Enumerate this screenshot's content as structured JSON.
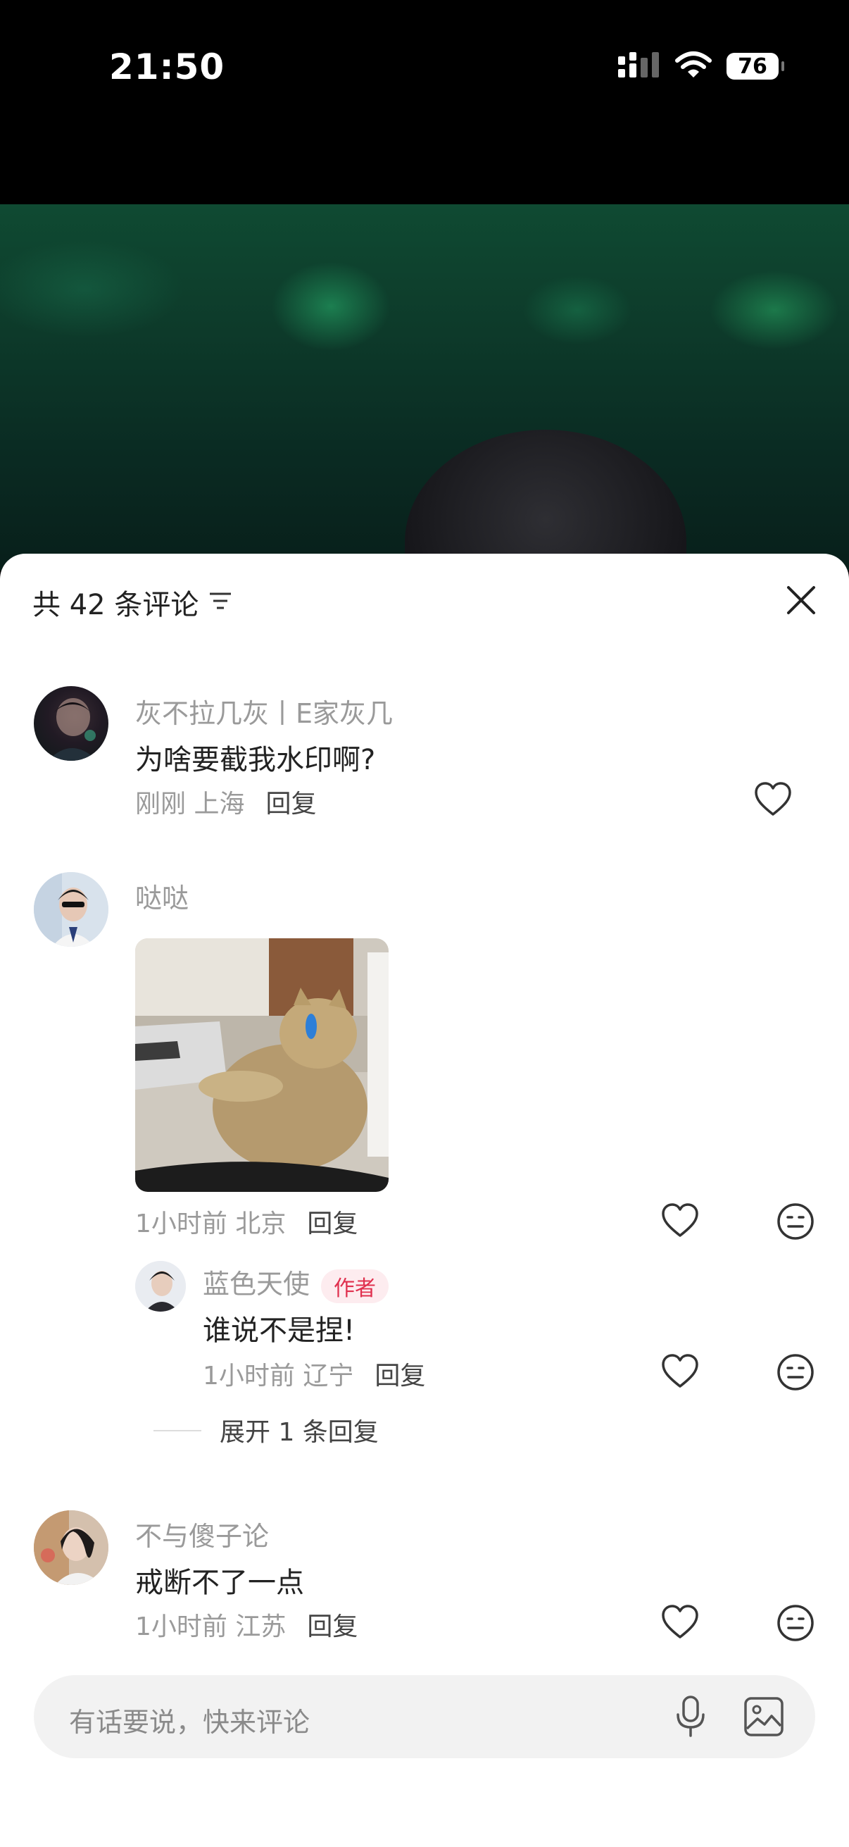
{
  "status": {
    "time": "21:50",
    "battery": "76"
  },
  "sheet": {
    "title": "共 42 条评论"
  },
  "comments": [
    {
      "user": "灰不拉几灰丨E家灰几",
      "text": "为啥要截我水印啊?",
      "time_loc": "刚刚 上海",
      "reply": "回复"
    },
    {
      "user": "哒哒",
      "time_loc": "1小时前 北京",
      "reply": "回复"
    },
    {
      "user": "不与傻子论",
      "text": "戒断不了一点",
      "time_loc": "1小时前 江苏",
      "reply": "回复"
    }
  ],
  "sub_reply": {
    "user": "蓝色天使",
    "badge": "作者",
    "text": "谁说不是捏!",
    "time_loc": "1小时前 辽宁",
    "reply": "回复"
  },
  "expand": {
    "label": "展开 1 条回复"
  },
  "input": {
    "placeholder": "有话要说，快来评论"
  },
  "icons": [
    "signal-icon",
    "wifi-icon",
    "battery-icon",
    "sort-icon",
    "close-icon",
    "heart-icon",
    "emoji-icon",
    "mic-icon",
    "image-icon"
  ],
  "colors": {
    "author_badge_bg": "#fdecef",
    "author_badge_text": "#e0304e"
  }
}
